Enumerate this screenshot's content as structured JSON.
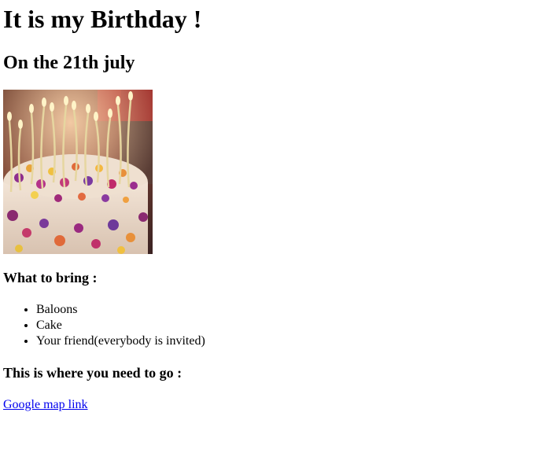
{
  "page": {
    "title": "It is my Birthday !",
    "subtitle": "On the 21th july"
  },
  "image": {
    "semantic": "birthday-cake-with-candles-photo",
    "alt": ""
  },
  "bring": {
    "heading": "What to bring :",
    "items": [
      {
        "label": "Baloons"
      },
      {
        "label": "Cake"
      },
      {
        "label": "Your friend(everybody is invited)"
      }
    ]
  },
  "location": {
    "heading": "This is where you need to go :",
    "link_label": "Google map link"
  },
  "colors": {
    "text": "#000000",
    "link": "#0000ee",
    "background": "#ffffff"
  }
}
